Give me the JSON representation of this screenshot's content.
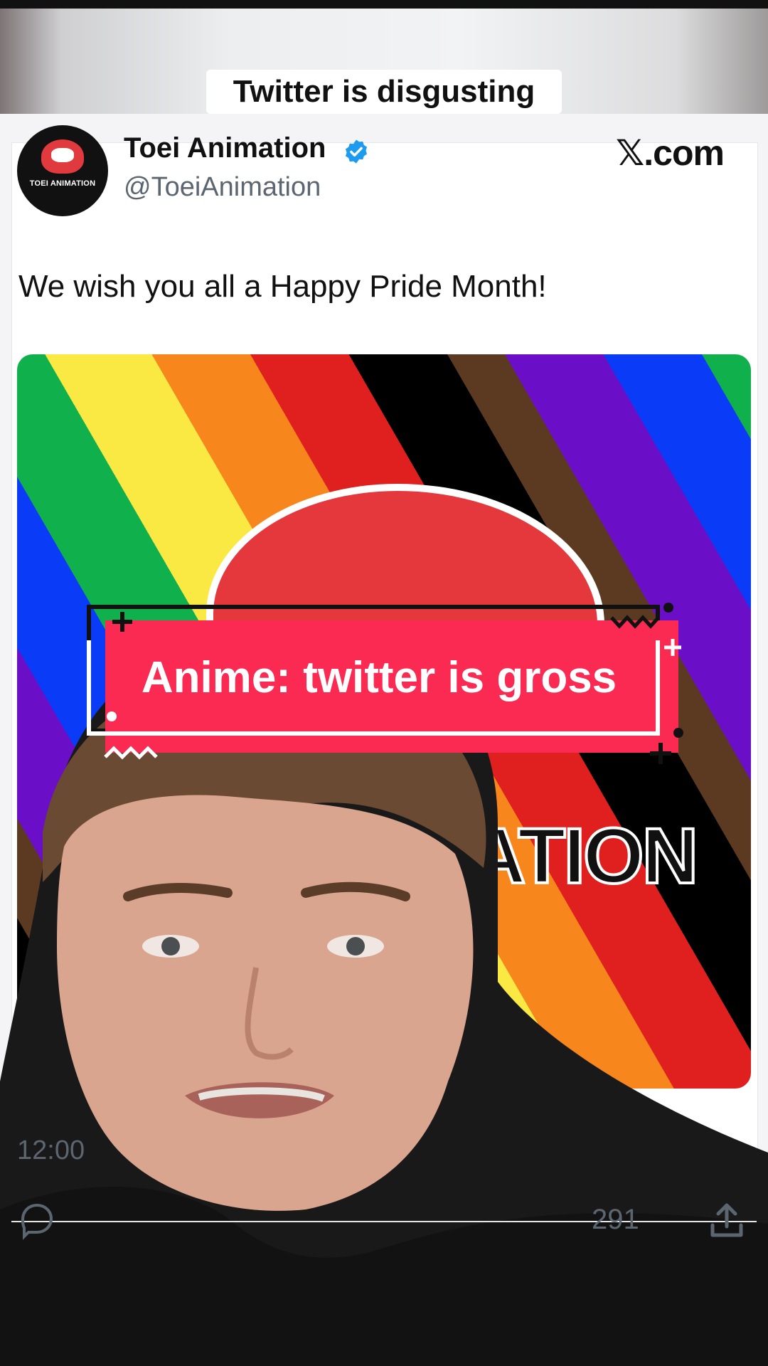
{
  "top_caption": "Twitter is disgusting",
  "tweet": {
    "avatar_text": "TOEI ANIMATION",
    "display_name": "Toei Animation",
    "handle": "@ToeiAnimation",
    "site_label": "𝕏.com",
    "text": "We wish you all a Happy Pride Month!",
    "time": "12:00",
    "count": "291"
  },
  "media": {
    "logo_partial_text": "ATION"
  },
  "overlay_caption": "Anime: twitter is gross",
  "colors": {
    "caption_red": "#fa2a52",
    "verified_blue": "#1d9bf0",
    "stripe_colors": [
      "#000000",
      "#5b3a21",
      "#6a0ec7",
      "#0a3bf6",
      "#10b04c",
      "#fae843",
      "#f7861c",
      "#e01f1f"
    ]
  },
  "icons": [
    "verified-badge-icon",
    "reply-icon",
    "share-icon"
  ]
}
